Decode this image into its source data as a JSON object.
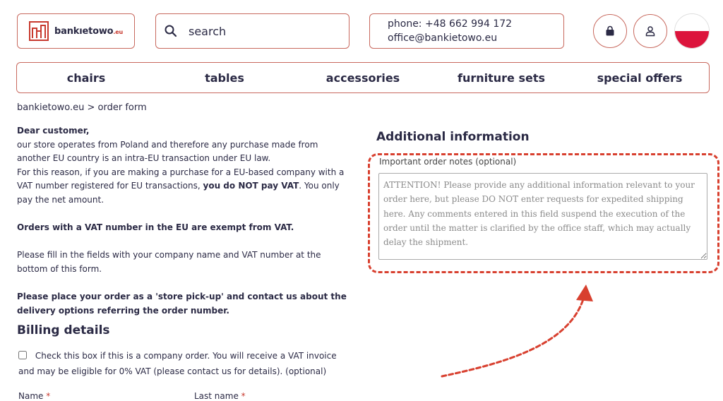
{
  "header": {
    "logo_text": "bankıetowo",
    "logo_tld": ".eu",
    "search_label": "search",
    "phone": "phone: +48 662 994 172",
    "email": "office@bankietowo.eu"
  },
  "nav": {
    "items": [
      {
        "label": "chairs"
      },
      {
        "label": "tables"
      },
      {
        "label": "accessories"
      },
      {
        "label": "furniture sets"
      },
      {
        "label": "special offers"
      }
    ]
  },
  "breadcrumb": "bankietowo.eu > order form",
  "intro": {
    "greeting": "Dear customer,",
    "p1": "our store operates from Poland and therefore any purchase made from another EU country is an intra-EU transaction under EU law.",
    "p2_a": "For this reason, if you are making a purchase for a EU-based company with a VAT number registered for EU transactions, ",
    "p2_bold": "you do NOT pay VAT",
    "p2_b": ". You only pay the net amount.",
    "p3": "Orders with a VAT number in the EU are exempt from VAT.",
    "p4": "Please fill in the fields with your company name and VAT number at the bottom of this form.",
    "p5": "Please place your order as a 'store pick-up' and contact us about the delivery options referring the order number."
  },
  "billing": {
    "title": "Billing details",
    "company_checkbox_label": "Check this box if this is a company order. You will receive a VAT invoice and may be eligible for 0% VAT (please contact us for details). (optional)",
    "name_label": "Name",
    "last_name_label": "Last name",
    "required_mark": "*"
  },
  "additional": {
    "title": "Additional information",
    "notes_label": "Important order notes (optional)",
    "notes_placeholder": "ATTENTION! Please provide any additional information relevant to your order here, but please DO NOT enter requests for expedited shipping here. Any comments entered in this field suspend the execution of the order until the matter is clarified by the office staff, which may actually delay the shipment."
  },
  "colors": {
    "brand_red": "#c8392e",
    "border": "#c8695e",
    "text": "#2b2a45",
    "annotation_red": "#d8402f"
  },
  "icons": {
    "cart": "shopping-bag-icon",
    "user": "user-icon",
    "search": "search-icon",
    "flag": "poland-flag-icon"
  }
}
